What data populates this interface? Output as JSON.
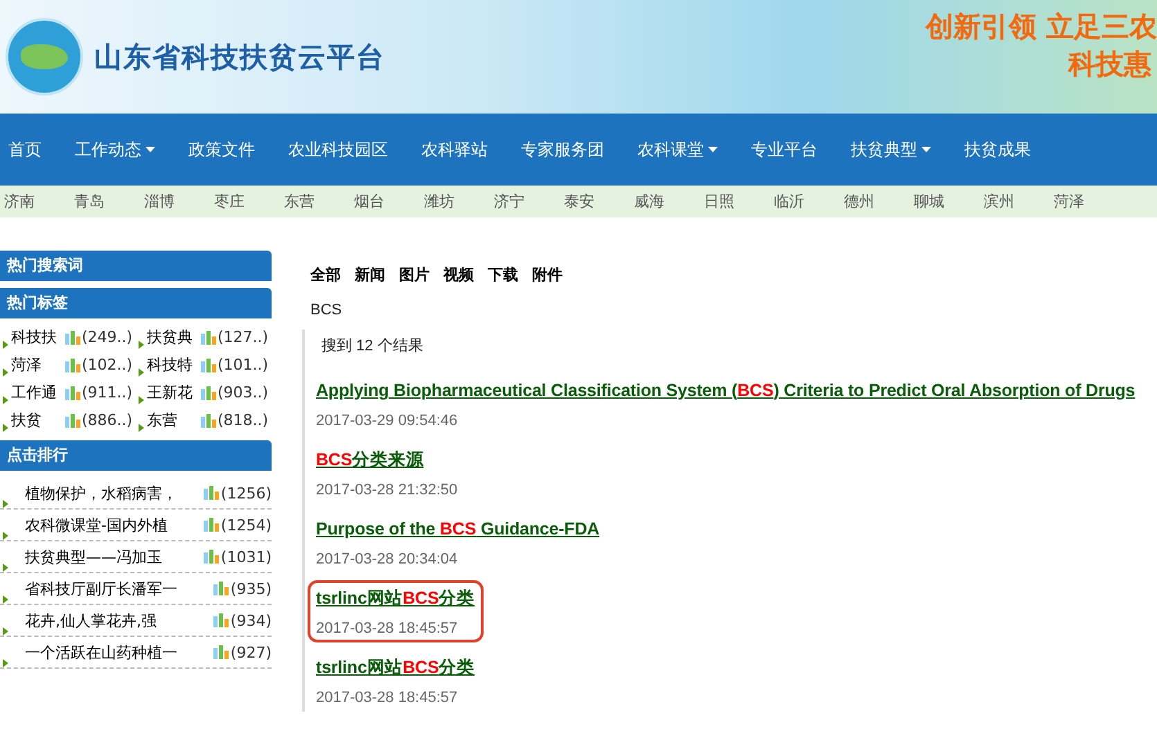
{
  "header": {
    "site_title": "山东省科技扶贫云平台",
    "slogan_line_1": "创新引领 立足三农",
    "slogan_line_2": "科技惠"
  },
  "nav": [
    {
      "label": "首页",
      "dropdown": false
    },
    {
      "label": "工作动态",
      "dropdown": true
    },
    {
      "label": "政策文件",
      "dropdown": false
    },
    {
      "label": "农业科技园区",
      "dropdown": false
    },
    {
      "label": "农科驿站",
      "dropdown": false
    },
    {
      "label": "专家服务团",
      "dropdown": false
    },
    {
      "label": "农科课堂",
      "dropdown": true
    },
    {
      "label": "专业平台",
      "dropdown": false
    },
    {
      "label": "扶贫典型",
      "dropdown": true
    },
    {
      "label": "扶贫成果",
      "dropdown": false
    }
  ],
  "cities": [
    "济南",
    "青岛",
    "淄博",
    "枣庄",
    "东营",
    "烟台",
    "潍坊",
    "济宁",
    "泰安",
    "威海",
    "日照",
    "临沂",
    "德州",
    "聊城",
    "滨州",
    "菏泽"
  ],
  "sidebar": {
    "hot_search_title": "热门搜索词",
    "hot_tags_title": "热门标签",
    "hot_tags": [
      {
        "name": "科技扶",
        "count": "(249..)"
      },
      {
        "name": "扶贫典",
        "count": "(127..)"
      },
      {
        "name": "菏泽",
        "count": "(102..)"
      },
      {
        "name": "科技特",
        "count": "(101..)"
      },
      {
        "name": "工作通",
        "count": "(911..)"
      },
      {
        "name": "王新花",
        "count": "(903..)"
      },
      {
        "name": "扶贫",
        "count": "(886..)"
      },
      {
        "name": "东营",
        "count": "(818..)"
      }
    ],
    "ranking_title": "点击排行",
    "ranking": [
      {
        "title": "植物保护，水稻病害，",
        "count": "(1256)"
      },
      {
        "title": "农科微课堂-国内外植",
        "count": "(1254)"
      },
      {
        "title": "扶贫典型——冯加玉",
        "count": "(1031)"
      },
      {
        "title": "省科技厅副厅长潘军一",
        "count": "(935)"
      },
      {
        "title": "花卉,仙人掌花卉,强",
        "count": "(934)"
      },
      {
        "title": "一个活跃在山药种植一",
        "count": "(927)"
      }
    ]
  },
  "search": {
    "filters": [
      "全部",
      "新闻",
      "图片",
      "视频",
      "下载",
      "附件"
    ],
    "query": "BCS",
    "summary": "搜到 12 个结果",
    "results": [
      {
        "title_parts": [
          {
            "text": "Applying Biopharmaceutical Classification System (",
            "highlight": false
          },
          {
            "text": "BCS",
            "highlight": true
          },
          {
            "text": ") Criteria to Predict Oral Absorption of Drugs",
            "highlight": false
          }
        ],
        "date": "2017-03-29 09:54:46",
        "outlined": false
      },
      {
        "title_parts": [
          {
            "text": "BCS",
            "highlight": true
          },
          {
            "text": "分类来源",
            "highlight": false
          }
        ],
        "date": "2017-03-28 21:32:50",
        "outlined": false
      },
      {
        "title_parts": [
          {
            "text": "Purpose of the ",
            "highlight": false
          },
          {
            "text": "BCS",
            "highlight": true
          },
          {
            "text": " Guidance-FDA",
            "highlight": false
          }
        ],
        "date": "2017-03-28 20:34:04",
        "outlined": false
      },
      {
        "title_parts": [
          {
            "text": "tsrlinc网站",
            "highlight": false
          },
          {
            "text": "BCS",
            "highlight": true
          },
          {
            "text": "分类",
            "highlight": false
          }
        ],
        "date": "2017-03-28 18:45:57",
        "outlined": true
      },
      {
        "title_parts": [
          {
            "text": "tsrlinc网站",
            "highlight": false
          },
          {
            "text": "BCS",
            "highlight": true
          },
          {
            "text": "分类",
            "highlight": false
          }
        ],
        "date": "2017-03-28 18:45:57",
        "outlined": false
      }
    ]
  }
}
